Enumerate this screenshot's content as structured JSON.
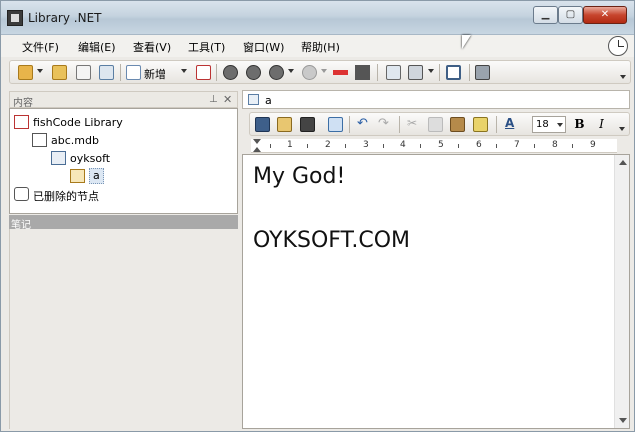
{
  "window": {
    "title": "Library .NET"
  },
  "menu": [
    {
      "label": "文件(F)"
    },
    {
      "label": "编辑(E)"
    },
    {
      "label": "查看(V)"
    },
    {
      "label": "工具(T)"
    },
    {
      "label": "窗口(W)"
    },
    {
      "label": "帮助(H)"
    }
  ],
  "toolbar": {
    "new_label": "新增"
  },
  "left_pane": {
    "title": "内容",
    "tree": [
      {
        "label": "fishCode Library",
        "icon": "library-icon"
      },
      {
        "label": "abc.mdb",
        "icon": "database-icon"
      },
      {
        "label": "oyksoft",
        "icon": "folder-node-icon"
      },
      {
        "label": "a",
        "icon": "note-node-icon"
      },
      {
        "label": "已删除的节点",
        "icon": "recycle-bin-icon"
      }
    ],
    "notes_label": "笔记"
  },
  "doc": {
    "tab_label": "a",
    "font_size": "18",
    "ruler_numbers": [
      "1",
      "2",
      "3",
      "4",
      "5",
      "6",
      "7",
      "8",
      "9"
    ],
    "lines": [
      "My God!",
      "OYKSOFT.COM"
    ]
  },
  "colors": {
    "accent": "#c7452e",
    "selection": "#dce7f3"
  }
}
